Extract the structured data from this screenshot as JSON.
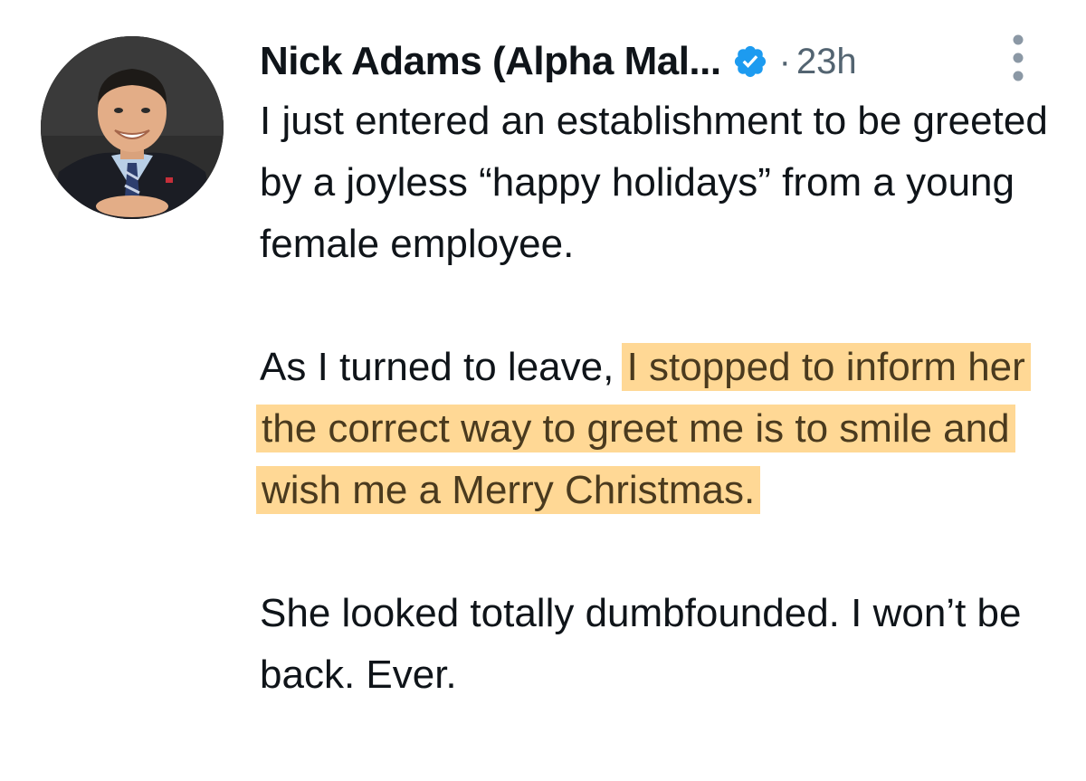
{
  "tweet": {
    "author_name": "Nick Adams (Alpha Mal...",
    "separator": "·",
    "timestamp": "23h",
    "avatar_icon": "profile-photo",
    "verified_icon": "verified-badge-icon",
    "more_icon": "more-options-icon",
    "accent_color": "#1d9bf0",
    "highlight_color": "#ffb83e",
    "paragraphs": [
      {
        "text": "I just entered an establishment to be greeted by a joyless “happy holidays” from a young female employee."
      },
      {
        "before": "As I turned to leave, ",
        "highlighted": "I stopped to inform her the correct way to greet me is to smile and wish me a Merry Christmas."
      },
      {
        "text": "She looked totally dumbfounded. I won’t be back. Ever."
      }
    ]
  }
}
